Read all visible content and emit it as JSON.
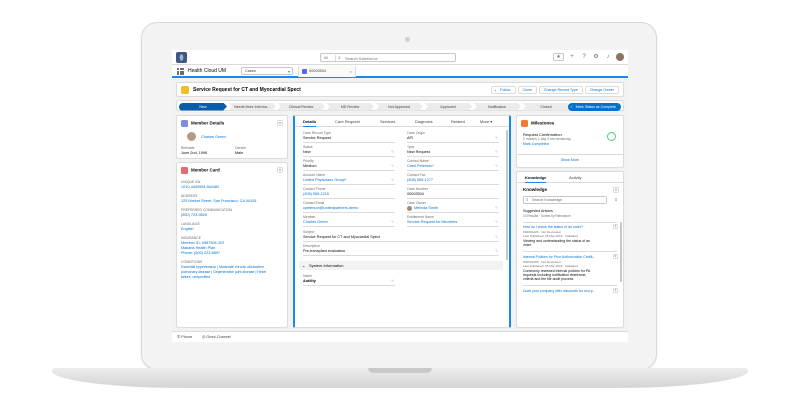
{
  "search": {
    "scope": "All",
    "placeholder": "Search Salesforce"
  },
  "nav": {
    "app_name": "Health Cloud UM",
    "object_select": "Cases",
    "tab_label": "00002504"
  },
  "record": {
    "title": "Service Request for CT and Myocardial Spect",
    "buttons": {
      "follow": "Follow",
      "clone": "Clone",
      "change_record_type": "Change Record Type",
      "change_owner": "Change Owner"
    }
  },
  "path": {
    "steps": [
      "New",
      "Needs More Informa...",
      "Clinical Review",
      "MD Review",
      "Not Approved",
      "Approved",
      "Notification",
      "Closed"
    ],
    "mark_status": "Mark Status as Complete"
  },
  "member_details": {
    "title": "Member Details",
    "name": "Charles Green",
    "birthdate_label": "Birthdate",
    "birthdate": "June 2nd, 1996",
    "gender_label": "Gender",
    "gender": "Male"
  },
  "member_card": {
    "title": "Member Card",
    "unique_id_label": "UNIQUE ID#",
    "unique_id": "1010-4449594-9s0482",
    "address_label": "ADDRESS",
    "address": "125 Market Street, San Francisco, CA 94105",
    "comm_label": "PREFERRED COMMUNICATION",
    "comm": "(550) 723-9825",
    "language_label": "LANGUAGE",
    "language": "English",
    "insurance_label": "INSURANCE",
    "insurance_lines": [
      "Member ID: 0987504-322",
      "Makana Health Plan",
      "Phone: (800) 223-6897"
    ],
    "conditions_label": "CONDITIONS",
    "conditions": [
      "Essential hypertension | Moderate chronic obstructive",
      "pulmonary disease | Degenerative joint disease | Heart",
      "failure, unspecified"
    ]
  },
  "detail_tabs": [
    "Details",
    "Care Request",
    "Services",
    "Diagnosis",
    "Related",
    "More"
  ],
  "details_left": [
    {
      "label": "Case Record Type",
      "value": "Service Request",
      "link": false
    },
    {
      "label": "Status",
      "value": "New",
      "link": false
    },
    {
      "label": "Priority",
      "value": "Medium",
      "link": false
    },
    {
      "label": "Account Name",
      "value": "United Physicians Group*",
      "link": true
    },
    {
      "label": "Contact Phone",
      "value": "(408) 555-1216",
      "link": true
    },
    {
      "label": "Contact Email",
      "value": "cpeterson@unitedpartners.demo",
      "link": true
    },
    {
      "label": "Member",
      "value": "Charles Green",
      "link": true
    }
  ],
  "details_right": [
    {
      "label": "Case Origin",
      "value": "API",
      "link": false
    },
    {
      "label": "Type",
      "value": "New Request",
      "link": false
    },
    {
      "label": "Contact Name",
      "value": "Carol Peterson*",
      "link": true
    },
    {
      "label": "Contact Fax",
      "value": "(408) 555-1277",
      "link": true
    },
    {
      "label": "Case Number",
      "value": "00002504",
      "link": false
    },
    {
      "label": "Case Owner",
      "value": "Melinda Smith",
      "link": true
    },
    {
      "label": "Entitlement Name",
      "value": "Service Request for Members",
      "link": true
    }
  ],
  "subject": {
    "label": "Subject",
    "value": "Service Request for CT and Myocardial Spect"
  },
  "description": {
    "label": "Description",
    "value": "Pre-transplant evaluation"
  },
  "system_info": {
    "title": "System Information",
    "name_label": "Name",
    "name_value": "Autility"
  },
  "milestones": {
    "title": "Milestones",
    "item_title": "Request Confirmation",
    "item_sub": "2 months 1 day 3 hrs remaining",
    "mark_completed": "Mark Completed",
    "show_more": "Show More"
  },
  "knowledge": {
    "tabs": [
      "Knowledge",
      "Activity"
    ],
    "title": "Knowledge",
    "search_placeholder": "Search Knowledge",
    "suggested": "Suggested Articles",
    "results": "10 Results · Sorted by Relevance",
    "articles": [
      {
        "title": "How do I check the status of an order?",
        "meta1": "000001226 · Not Reviewed",
        "meta2": "Last Published: 25 Mar 2019 · Validated",
        "desc": [
          "Viewing and understanding the status of an",
          "order."
        ]
      },
      {
        "title": "Internal Policies for Prior Authorization Certifi...",
        "meta1": "000001208 · Not Reviewed",
        "meta2": "Last Published: 25 Mar 2019 · Validated",
        "desc": [
          "Commonly reviewed internal policies for PA",
          "requests including notification timeframe,",
          "criteria and the file audit process"
        ]
      },
      {
        "title": "Does your company offer discounts for non-p...",
        "meta1": "",
        "meta2": "",
        "desc": []
      }
    ]
  },
  "utility": {
    "phone": "Phone",
    "omni": "Omni-Channel"
  },
  "colors": {
    "brand": "#0070d2",
    "path_current": "#0b5cab",
    "member_icon": "#7f8de1",
    "card_icon": "#e9696e",
    "milestone_icon": "#ef7c30",
    "tab_highlight": "#1589ee"
  }
}
